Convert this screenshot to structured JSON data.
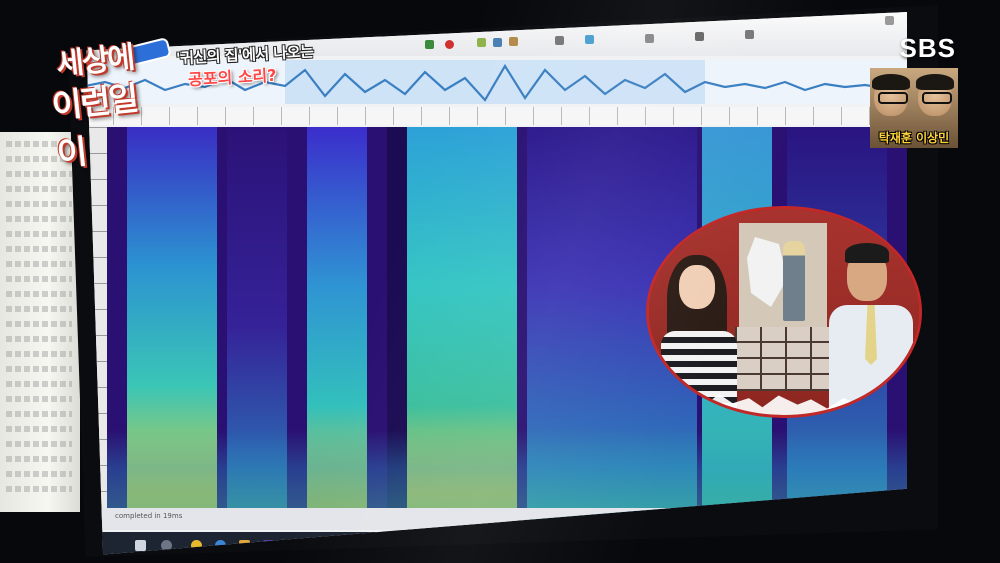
{
  "title": {
    "logo_line1": "세상에",
    "logo_line2": "이런일이",
    "caption_line1": "'귀신의 집'에서 나오는",
    "caption_line2": "공포의 소리?"
  },
  "broadcaster": {
    "logo": "SBS"
  },
  "hosts": {
    "names": "탁재훈 이상민"
  },
  "software": {
    "status": "completed in 19ms"
  },
  "colors": {
    "caption_red": "#ff4747",
    "brand_red": "#c22828",
    "spectrogram_base": "#2a1072",
    "spectrogram_hot": "#d4d24a",
    "spectrogram_mid": "#2fc7d2"
  },
  "icons": [
    "logo-badge",
    "windows-start-icon",
    "browser-icon",
    "folder-icon",
    "app-icon"
  ]
}
